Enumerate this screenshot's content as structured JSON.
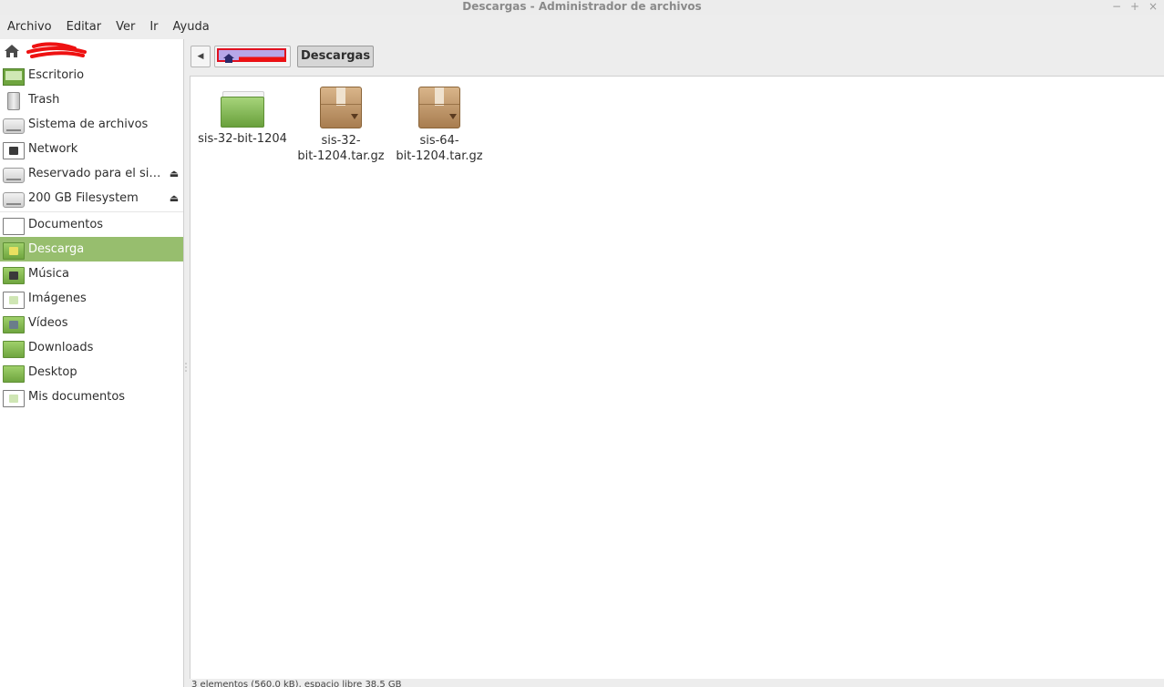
{
  "window": {
    "title": "Descargas - Administrador de archivos",
    "controls": [
      "−",
      "+",
      "×"
    ]
  },
  "menu": {
    "items": [
      "Archivo",
      "Editar",
      "Ver",
      "Ir",
      "Ayuda"
    ]
  },
  "sidebar": {
    "home_icon": "home-icon",
    "devices": [
      {
        "label": "Escritorio",
        "icon": "desktop-icon"
      },
      {
        "label": "Trash",
        "icon": "trash-icon"
      },
      {
        "label": "Sistema de archivos",
        "icon": "drive-icon"
      },
      {
        "label": "Network",
        "icon": "network-folder-icon"
      },
      {
        "label": "Reservado para el si…",
        "icon": "drive-icon",
        "eject": "⏏"
      },
      {
        "label": "200 GB Filesystem",
        "icon": "drive-icon",
        "eject": "⏏"
      }
    ],
    "places": [
      {
        "label": "Documentos",
        "icon": "documents-folder-icon"
      },
      {
        "label": "Descarga",
        "icon": "download-folder-icon",
        "selected": true
      },
      {
        "label": "Música",
        "icon": "music-folder-icon"
      },
      {
        "label": "Imágenes",
        "icon": "pictures-folder-icon"
      },
      {
        "label": "Vídeos",
        "icon": "videos-folder-icon"
      },
      {
        "label": "Downloads",
        "icon": "folder-icon"
      },
      {
        "label": "Desktop",
        "icon": "folder-icon"
      },
      {
        "label": "Mis documentos",
        "icon": "documents-folder-icon"
      }
    ],
    "selected_color": "#97be6e"
  },
  "pathbar": {
    "back": "◀",
    "current": "Descargas"
  },
  "files": [
    {
      "name": "sis-32-bit-1204",
      "type": "folder",
      "icon": "folder-icon"
    },
    {
      "name": "sis-32-bit-1204.tar.gz",
      "line1": "sis-32-",
      "line2": "bit-1204.tar.gz",
      "type": "archive",
      "icon": "package-icon"
    },
    {
      "name": "sis-64-bit-1204.tar.gz",
      "line1": "sis-64-",
      "line2": "bit-1204.tar.gz",
      "type": "archive",
      "icon": "package-icon"
    }
  ],
  "status": {
    "text": "3 elementos (560,0 kB), espacio libre 38,5 GB"
  }
}
